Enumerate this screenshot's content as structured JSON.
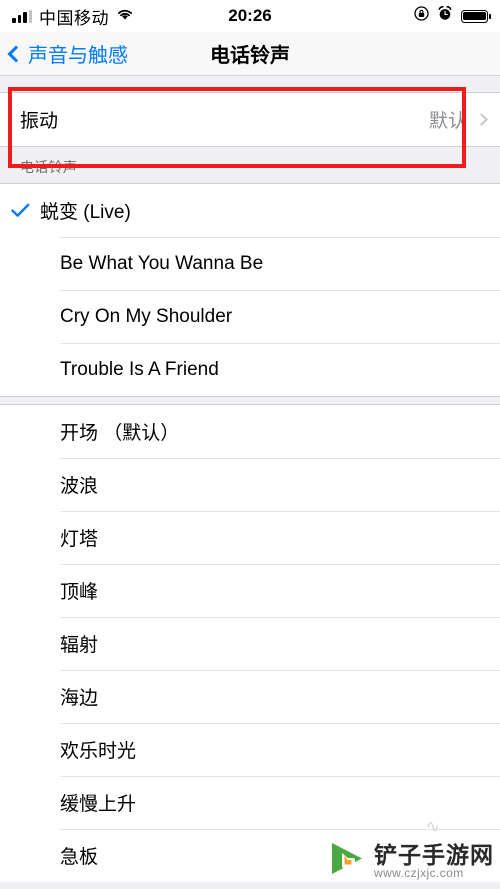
{
  "status_bar": {
    "carrier": "中国移动",
    "time": "20:26",
    "signal_icon": "signal-bars-icon",
    "wifi_icon": "wifi-icon",
    "rotation_lock_icon": "rotation-lock-icon",
    "alarm_icon": "alarm-clock-icon",
    "battery_icon": "battery-icon"
  },
  "nav": {
    "back_label": "声音与触感",
    "title": "电话铃声"
  },
  "vibration_row": {
    "label": "振动",
    "value": "默认",
    "chevron_icon": "chevron-right-icon"
  },
  "section": {
    "header": "电话铃声"
  },
  "ringtones": {
    "group1": [
      {
        "name": "蜕变 (Live)",
        "selected": true
      },
      {
        "name": "Be What You Wanna Be",
        "selected": false
      },
      {
        "name": "Cry On My Shoulder",
        "selected": false
      },
      {
        "name": "Trouble Is A Friend",
        "selected": false
      }
    ],
    "group2": [
      {
        "name": "开场 （默认）",
        "selected": false
      },
      {
        "name": "波浪",
        "selected": false
      },
      {
        "name": "灯塔",
        "selected": false
      },
      {
        "name": "顶峰",
        "selected": false
      },
      {
        "name": "辐射",
        "selected": false
      },
      {
        "name": "海边",
        "selected": false
      },
      {
        "name": "欢乐时光",
        "selected": false
      },
      {
        "name": "缓慢上升",
        "selected": false
      },
      {
        "name": "急板",
        "selected": false
      }
    ]
  },
  "annotation": {
    "color": "#ef1c1c"
  },
  "watermark": {
    "title": "铲子手游网",
    "url": "www.czjxjc.com",
    "logo_icon": "cursor-play-logo-icon"
  },
  "colors": {
    "accent": "#007aff",
    "background": "#efeff4",
    "row": "#ffffff",
    "secondary_text": "#8e8e93"
  }
}
